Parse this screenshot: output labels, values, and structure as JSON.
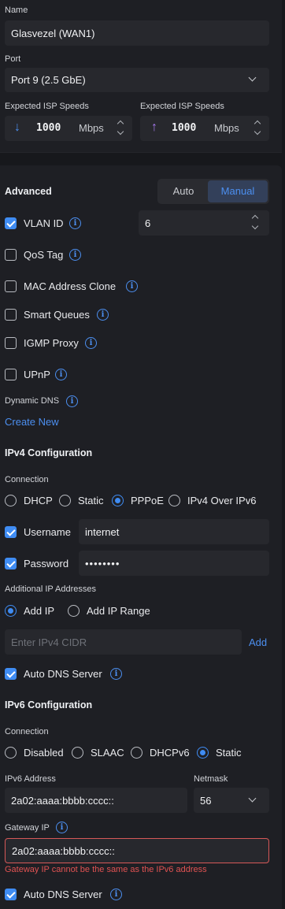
{
  "name_section": {
    "label": "Name",
    "value": "Glasvezel (WAN1)"
  },
  "port_section": {
    "label": "Port",
    "value": "Port 9 (2.5 GbE)"
  },
  "speeds": {
    "download": {
      "label": "Expected ISP Speeds",
      "value": "1000",
      "unit": "Mbps"
    },
    "upload": {
      "label": "Expected ISP Speeds",
      "value": "1000",
      "unit": "Mbps"
    }
  },
  "advanced": {
    "title": "Advanced",
    "mode_options": [
      "Auto",
      "Manual"
    ],
    "selected_mode": "Manual",
    "vlan": {
      "label": "VLAN ID",
      "checked": true,
      "value": "6"
    },
    "qos": {
      "label": "QoS Tag",
      "checked": false
    },
    "mac_clone": {
      "label": "MAC Address Clone",
      "checked": false
    },
    "smart_queues": {
      "label": "Smart Queues",
      "checked": false
    },
    "igmp_proxy": {
      "label": "IGMP Proxy",
      "checked": false
    },
    "upnp": {
      "label": "UPnP",
      "checked": false
    },
    "dynamic_dns": {
      "label": "Dynamic DNS",
      "create_link": "Create New"
    }
  },
  "ipv4": {
    "title": "IPv4 Configuration",
    "connection_label": "Connection",
    "connection_options": [
      "DHCP",
      "Static",
      "PPPoE",
      "IPv4 Over IPv6"
    ],
    "selected_connection": "PPPoE",
    "username": {
      "label": "Username",
      "checked": true,
      "value": "internet"
    },
    "password": {
      "label": "Password",
      "checked": true,
      "value": "••••••••"
    },
    "additional_ip_label": "Additional IP Addresses",
    "additional_options": [
      "Add IP",
      "Add IP Range"
    ],
    "selected_additional": "Add IP",
    "cidr_placeholder": "Enter IPv4 CIDR",
    "add_button": "Add",
    "auto_dns": {
      "label": "Auto DNS Server",
      "checked": true
    }
  },
  "ipv6": {
    "title": "IPv6 Configuration",
    "connection_label": "Connection",
    "connection_options": [
      "Disabled",
      "SLAAC",
      "DHCPv6",
      "Static"
    ],
    "selected_connection": "Static",
    "address": {
      "label": "IPv6 Address",
      "value": "2a02:aaaa:bbbb:cccc::"
    },
    "netmask": {
      "label": "Netmask",
      "value": "56"
    },
    "gateway": {
      "label": "Gateway IP",
      "value": "2a02:aaaa:bbbb:cccc::",
      "error": "Gateway IP cannot be the same as the IPv6 address"
    },
    "auto_dns": {
      "label": "Auto DNS Server",
      "checked": true
    }
  },
  "colors": {
    "accent": "#3f8cf3",
    "error": "#d65858",
    "download_arrow": "#4c8ff0",
    "upload_arrow": "#a77af0"
  }
}
